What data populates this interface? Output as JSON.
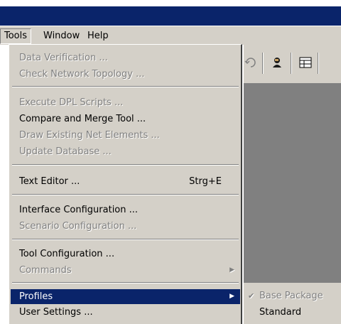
{
  "menubar": {
    "items": [
      {
        "label": "Tools",
        "active": true
      },
      {
        "label": "Window",
        "active": false
      },
      {
        "label": "Help",
        "active": false
      }
    ]
  },
  "tools_menu": {
    "groups": [
      [
        {
          "label": "Data Verification ...",
          "enabled": false
        },
        {
          "label": "Check Network Topology ...",
          "enabled": false
        }
      ],
      [
        {
          "label": "Execute DPL Scripts ...",
          "enabled": false
        },
        {
          "label": "Compare and Merge Tool ...",
          "enabled": true
        },
        {
          "label": "Draw Existing Net Elements ...",
          "enabled": false
        },
        {
          "label": "Update Database ...",
          "enabled": false
        }
      ],
      [
        {
          "label": "Text Editor ...",
          "shortcut": "Strg+E",
          "enabled": true
        }
      ],
      [
        {
          "label": "Interface Configuration ...",
          "enabled": true
        },
        {
          "label": "Scenario Configuration ...",
          "enabled": false
        }
      ],
      [
        {
          "label": "Tool Configuration ...",
          "enabled": true
        },
        {
          "label": "Commands",
          "enabled": false,
          "submenu": true
        }
      ],
      [
        {
          "label": "Profiles",
          "enabled": true,
          "submenu": true,
          "highlighted": true
        },
        {
          "label": "User Settings ...",
          "enabled": true
        }
      ]
    ]
  },
  "profiles_submenu": {
    "items": [
      {
        "label": "Base Package",
        "checked": true,
        "enabled": false
      },
      {
        "label": "Standard",
        "checked": false,
        "enabled": true
      }
    ]
  },
  "colors": {
    "title_bar": "#0a246a",
    "menu_face": "#d4d0c8",
    "highlight": "#0a246a",
    "workspace": "#808080"
  }
}
